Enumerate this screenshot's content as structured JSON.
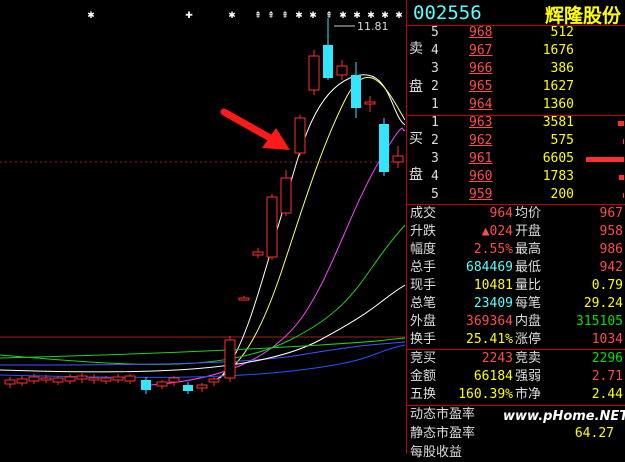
{
  "stock": {
    "code": "002556",
    "name": "辉隆股份"
  },
  "chart": {
    "high_label": "11.81",
    "colors": {
      "up": "#ff3030",
      "down": "#33e6ff",
      "ma5": "#ffffff",
      "ma10": "#ffff66",
      "ma20": "#ff44ff",
      "ma30": "#22cc22",
      "ma60": "#4455ff",
      "arrow": "#ff1a1a"
    }
  },
  "order_book": {
    "sell_label_1": "卖",
    "sell_label_2": "盘",
    "buy_label_1": "买",
    "buy_label_2": "盘",
    "asks": [
      {
        "level": "5",
        "price": "968",
        "volume": "512",
        "bar": 0.0
      },
      {
        "level": "4",
        "price": "967",
        "volume": "1676",
        "bar": 0.0
      },
      {
        "level": "3",
        "price": "966",
        "volume": "386",
        "bar": 0.0
      },
      {
        "level": "2",
        "price": "965",
        "volume": "1627",
        "bar": 0.0
      },
      {
        "level": "1",
        "price": "964",
        "volume": "1360",
        "bar": 0.0
      }
    ],
    "bids": [
      {
        "level": "1",
        "price": "963",
        "volume": "3581",
        "bar": 0.15
      },
      {
        "level": "2",
        "price": "962",
        "volume": "575",
        "bar": 0.03
      },
      {
        "level": "3",
        "price": "961",
        "volume": "6605",
        "bar": 1.0
      },
      {
        "level": "4",
        "price": "960",
        "volume": "1783",
        "bar": 0.12
      },
      {
        "level": "5",
        "price": "959",
        "volume": "200",
        "bar": 0.02
      }
    ]
  },
  "stats": [
    {
      "l1": "成交",
      "v1": "964",
      "c1": "red",
      "l2": "均价",
      "v2": "967",
      "c2": "red"
    },
    {
      "l1": "升跌",
      "v1": "▲024",
      "c1": "red",
      "l2": "开盘",
      "v2": "958",
      "c2": "red"
    },
    {
      "l1": "幅度",
      "v1": "2.55%",
      "c1": "red",
      "l2": "最高",
      "v2": "986",
      "c2": "red"
    },
    {
      "l1": "总手",
      "v1": "684469",
      "c1": "cyan",
      "l2": "最低",
      "v2": "942",
      "c2": "red"
    },
    {
      "l1": "现手",
      "v1": "10481",
      "c1": "yel",
      "l2": "量比",
      "v2": "0.79",
      "c2": "yel"
    },
    {
      "l1": "总笔",
      "v1": "23409",
      "c1": "cyan",
      "l2": "每笔",
      "v2": "29.24",
      "c2": "yel"
    },
    {
      "l1": "外盘",
      "v1": "369364",
      "c1": "red",
      "l2": "内盘",
      "v2": "315105",
      "c2": "grn"
    },
    {
      "l1": "换手",
      "v1": "25.41%",
      "c1": "yel",
      "l2": "涨停",
      "v2": "1034",
      "c2": "red"
    }
  ],
  "stats2": [
    {
      "l1": "竞买",
      "v1": "2243",
      "c1": "red",
      "l2": "竞卖",
      "v2": "2296",
      "c2": "grn"
    },
    {
      "l1": "金额",
      "v1": "66184",
      "c1": "yel",
      "l2": "强弱",
      "v2": "2.71",
      "c2": "red"
    },
    {
      "l1": "五换",
      "v1": "160.39%",
      "c1": "yel",
      "l2": "市净",
      "v2": "2.44",
      "c2": "yel"
    }
  ],
  "valuation": [
    {
      "label": "动态市盈率",
      "value": ""
    },
    {
      "label": "静态市盈率",
      "value": "64.27"
    },
    {
      "label": "每股收益",
      "value": ""
    }
  ],
  "watermark": "www.pHome.NET"
}
